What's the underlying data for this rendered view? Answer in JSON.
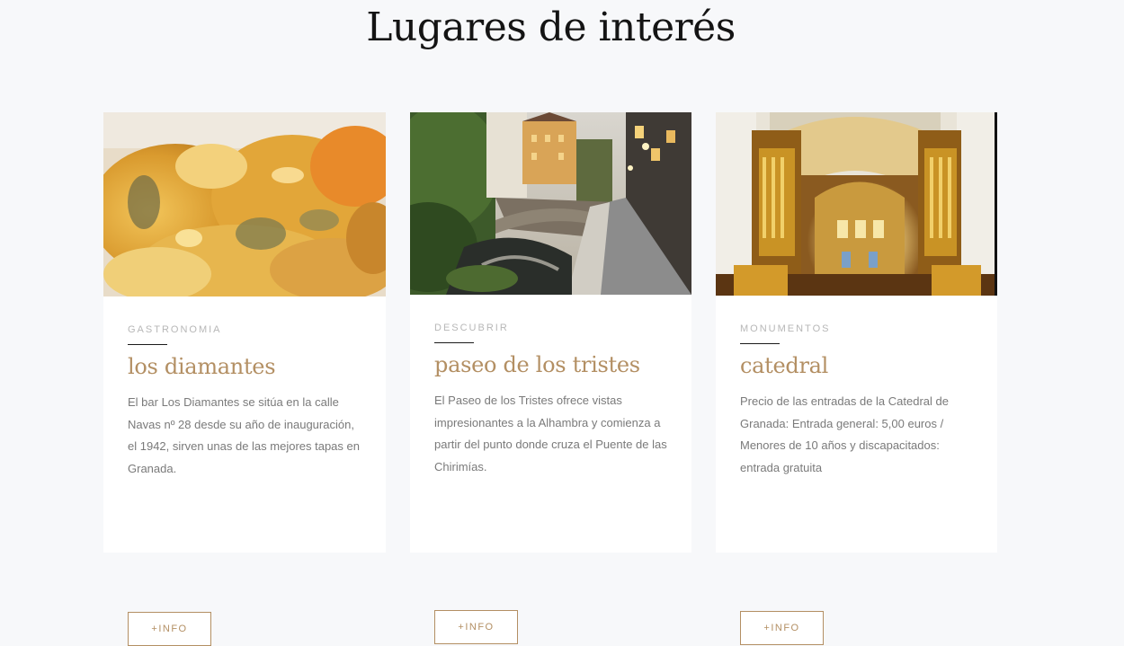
{
  "section": {
    "title": "Lugares de interés"
  },
  "cards": [
    {
      "category": "GASTRONOMIA",
      "title": "los diamantes",
      "description": "El bar Los Diamantes se sitúa en la calle Navas nº 28 desde su año de inauguración, el 1942, sirven unas de las mejores tapas en Granada.",
      "button": "+INFO",
      "image": "fried-fish-photo"
    },
    {
      "category": "DESCUBRIR",
      "title": "paseo de los tristes",
      "description": "El Paseo de los Tristes ofrece vistas impresionantes a la Alhambra y comienza a partir del punto donde cruza el Puente de las Chirimías.",
      "button": "+INFO",
      "image": "river-walk-photo"
    },
    {
      "category": "MONUMENTOS",
      "title": "catedral",
      "description": "Precio de las entradas de la Catedral de Granada: Entrada general: 5,00 euros / Menores de 10 años y discapacitados: entrada gratuita",
      "button": "+INFO",
      "image": "cathedral-interior-photo"
    }
  ],
  "colors": {
    "accent": "#b38f63",
    "background": "#f7f8fa",
    "card": "#ffffff",
    "text_muted": "#7a7a7a",
    "category": "#b7b7b7"
  }
}
